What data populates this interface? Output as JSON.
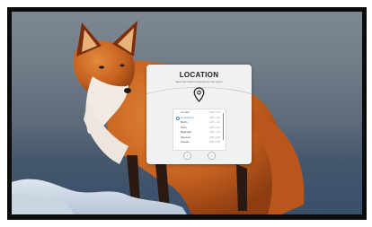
{
  "dialog": {
    "title": "LOCATION",
    "subtitle": "Select the location & timezone for this system",
    "pin_icon": "map-pin-icon",
    "locations": [
      {
        "name": "London",
        "tz": "GMT +0:00",
        "selected": false
      },
      {
        "name": "Amsterdam",
        "tz": "GMT +1:00",
        "selected": true
      },
      {
        "name": "Berlin",
        "tz": "GMT +1:00",
        "selected": false
      },
      {
        "name": "Paris",
        "tz": "GMT +1:00",
        "selected": false
      },
      {
        "name": "Baghdad",
        "tz": "GMT +3:00",
        "selected": false
      },
      {
        "name": "Moscow",
        "tz": "GMT +3:00",
        "selected": false
      },
      {
        "name": "Kuwait",
        "tz": "GMT +3:00",
        "selected": false
      }
    ],
    "prev_icon": "chevron-left-icon",
    "next_icon": "chevron-right-icon",
    "prev_label": "‹",
    "next_label": "›"
  },
  "colors": {
    "accent": "#3d8fd6",
    "dialog_bg": "#f1f1f2",
    "frame": "#0b0b0b"
  },
  "wallpaper": {
    "subject": "red-fox-in-snow"
  }
}
